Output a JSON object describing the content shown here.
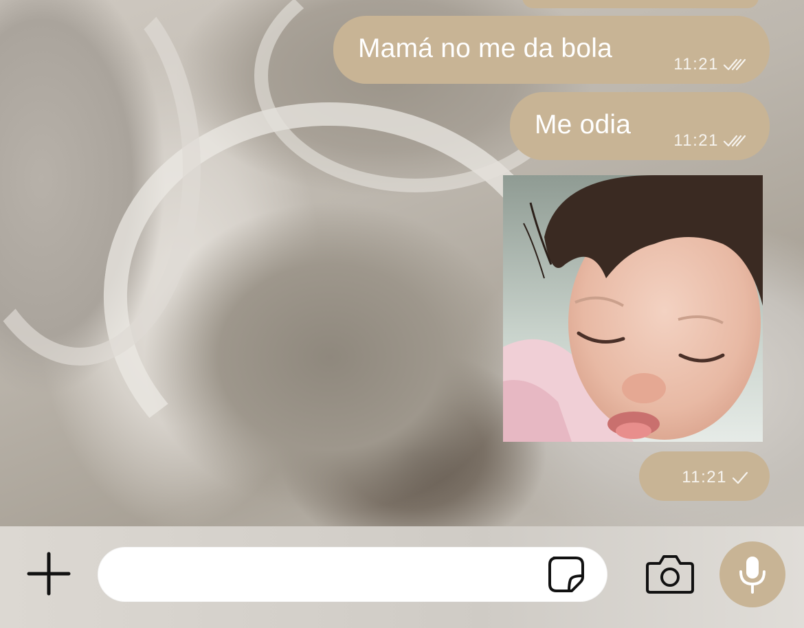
{
  "theme": {
    "bubble_color": "#c8b495",
    "bubble_text_color": "#ffffff",
    "input_bar_color": "#d8d4ce",
    "icon_color": "#111111"
  },
  "messages": [
    {
      "type": "text",
      "direction": "outgoing",
      "text": "Mamá no me da bola",
      "time": "11:21",
      "status": "read",
      "status_icon": "double-check-icon"
    },
    {
      "type": "text",
      "direction": "outgoing",
      "text": "Me odia",
      "time": "11:21",
      "status": "read",
      "status_icon": "double-check-icon"
    },
    {
      "type": "image",
      "direction": "outgoing",
      "time": "11:21",
      "status": "sent",
      "status_icon": "single-check-icon"
    }
  ],
  "input_bar": {
    "plus_icon": "plus-icon",
    "message_value": "",
    "message_placeholder": "",
    "sticker_icon": "sticker-icon",
    "camera_icon": "camera-icon",
    "mic_icon": "microphone-icon"
  }
}
